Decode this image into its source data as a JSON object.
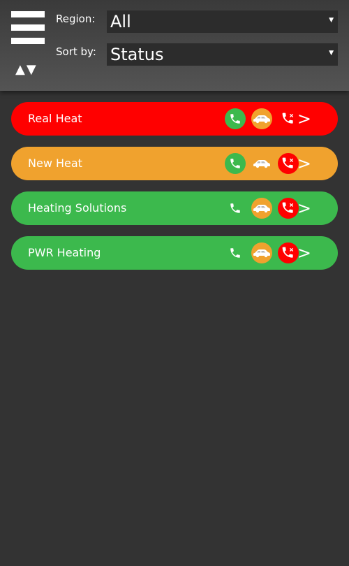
{
  "header": {
    "region_label": "Region:",
    "region_value": "All",
    "sort_label": "Sort by:",
    "sort_value": "Status",
    "sort_arrows": "▲▼",
    "caret": "▼"
  },
  "colors": {
    "red": "#ff0000",
    "orange": "#f0a22e",
    "green": "#3cb94d",
    "header_bg": "#4a4a4a",
    "page_bg": "#333333"
  },
  "rows": [
    {
      "name": "Real Heat",
      "status_color": "#ff0000",
      "phone_bg": "#3cb94d",
      "car_bg": "#f0a22e",
      "callx_bg": "none",
      "chevron": ">"
    },
    {
      "name": "New Heat",
      "status_color": "#f0a22e",
      "phone_bg": "#3cb94d",
      "car_bg": "none",
      "callx_bg": "#ff0000",
      "chevron": ">"
    },
    {
      "name": "Heating Solutions",
      "status_color": "#3cb94d",
      "phone_bg": "none",
      "car_bg": "#f0a22e",
      "callx_bg": "#ff0000",
      "chevron": ">"
    },
    {
      "name": "PWR Heating",
      "status_color": "#3cb94d",
      "phone_bg": "none",
      "car_bg": "#f0a22e",
      "callx_bg": "#ff0000",
      "chevron": ">"
    }
  ],
  "icons": [
    "phone-icon",
    "car-icon",
    "call-declined-icon",
    "chevron-right-icon",
    "menu-icon",
    "sort-arrows-icon"
  ]
}
